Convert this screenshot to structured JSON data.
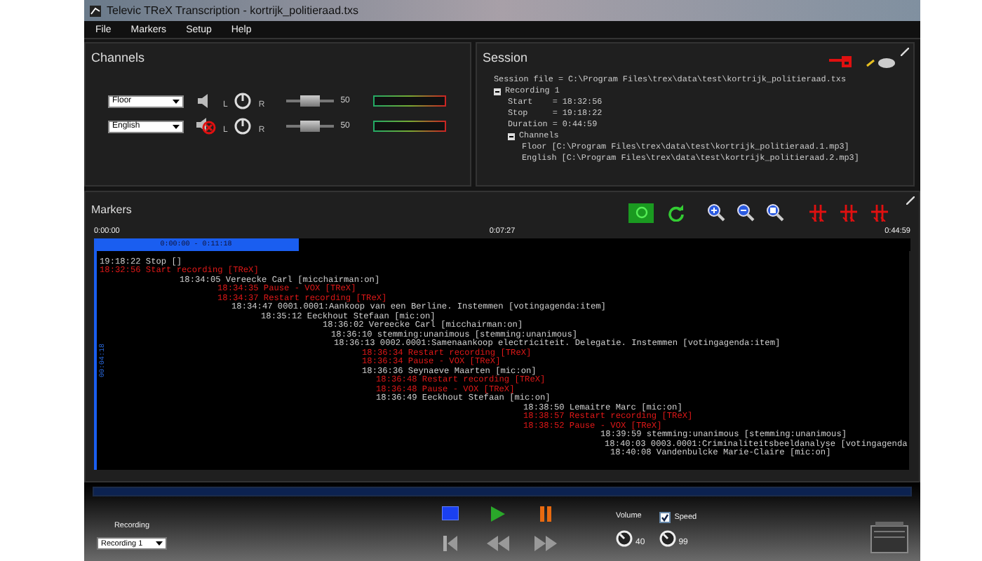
{
  "window": {
    "title": "Televic TReX Transcription - kortrijk_politieraad.txs"
  },
  "menu": [
    "File",
    "Markers",
    "Setup",
    "Help"
  ],
  "channels": {
    "title": "Channels",
    "rows": [
      {
        "source": "Floor",
        "muted": false,
        "balance_left": "L",
        "balance_right": "R",
        "level": 0.5,
        "slider_value": "50"
      },
      {
        "source": "English",
        "muted": true,
        "balance_left": "L",
        "balance_right": "R",
        "level": 0.5,
        "slider_value": "50"
      }
    ]
  },
  "session": {
    "title": "Session",
    "tree": [
      {
        "text": "Session file = C:\\Program Files\\trex\\data\\test\\kortrijk_politieraad.txs"
      },
      {
        "text": "Recording 1",
        "expanded": true,
        "children": [
          {
            "text": "Start    = 18:32:56"
          },
          {
            "text": "Stop     = 19:18:22"
          },
          {
            "text": "Duration = 0:44:59"
          },
          {
            "text": "Channels",
            "expanded": true,
            "children": [
              {
                "text": "Floor [C:\\Program Files\\trex\\data\\test\\kortrijk_politieraad.1.mp3]"
              },
              {
                "text": "English [C:\\Program Files\\trex\\data\\test\\kortrijk_politieraad.2.mp3]"
              }
            ]
          }
        ]
      }
    ]
  },
  "markers": {
    "title": "Markers",
    "toggle_on": true,
    "timeline": {
      "start": "0:00:00",
      "middle": "0:07:27",
      "end": "0:44:59",
      "selection": "0:00:00 - 0:11:18",
      "level": 0.25
    },
    "side_label": "00:04:18",
    "log": [
      {
        "kind": "event",
        "text": "19:18:22 Stop []"
      },
      {
        "kind": "system",
        "text": "18:32:56 Start recording [TReX]"
      },
      {
        "kind": "event",
        "text": "18:34:05 Vereecke Carl [micchairman:on]"
      },
      {
        "kind": "system",
        "text": "18:34:35 Pause - VOX [TReX]"
      },
      {
        "kind": "system",
        "text": "18:34:37 Restart recording [TReX]"
      },
      {
        "kind": "event",
        "text": "18:34:47 0001.0001:Aankoop van een Berline. Instemmen [votingagenda:item]"
      },
      {
        "kind": "event",
        "text": "18:35:12 Eeckhout Stefaan [mic:on]"
      },
      {
        "kind": "event",
        "text": "18:36:02 Vereecke Carl [micchairman:on]"
      },
      {
        "kind": "event",
        "text": "18:36:10 stemming:unanimous [stemming:unanimous]"
      },
      {
        "kind": "event",
        "text": "18:36:13 0002.0001:Samenaankoop electriciteit. Delegatie. Instemmen [votingagenda:item]"
      },
      {
        "kind": "system",
        "text": "18:36:34 Restart recording [TReX]"
      },
      {
        "kind": "system",
        "text": "18:36:34 Pause - VOX [TReX]"
      },
      {
        "kind": "event",
        "text": "18:36:36 Seynaeve Maarten [mic:on]"
      },
      {
        "kind": "system",
        "text": "18:36:48 Restart recording [TReX]"
      },
      {
        "kind": "system",
        "text": "18:36:48 Pause - VOX [TReX]"
      },
      {
        "kind": "event",
        "text": "18:36:49 Eeckhout Stefaan [mic:on]"
      },
      {
        "kind": "event",
        "text": "18:38:50 Lemaitre Marc [mic:on]"
      },
      {
        "kind": "system",
        "text": "18:38:57 Restart recording [TReX]"
      },
      {
        "kind": "system",
        "text": "18:38:52 Pause - VOX [TReX]"
      },
      {
        "kind": "event",
        "text": "18:39:59 stemming:unanimous [stemming:unanimous]"
      },
      {
        "kind": "event",
        "text": "18:40:03 0003.0001:Criminaliteitsbeeldanalyse [votingagenda"
      },
      {
        "kind": "event",
        "text": "18:40:08 Vandenbulcke Marie-Claire [mic:on]"
      }
    ]
  },
  "transport": {
    "recording_label": "Recording",
    "recording": "Recording 1",
    "volume_label": "Volume",
    "speed_label": "Speed",
    "speed_checked": true,
    "volume_value": "40",
    "speed_value": "99"
  }
}
